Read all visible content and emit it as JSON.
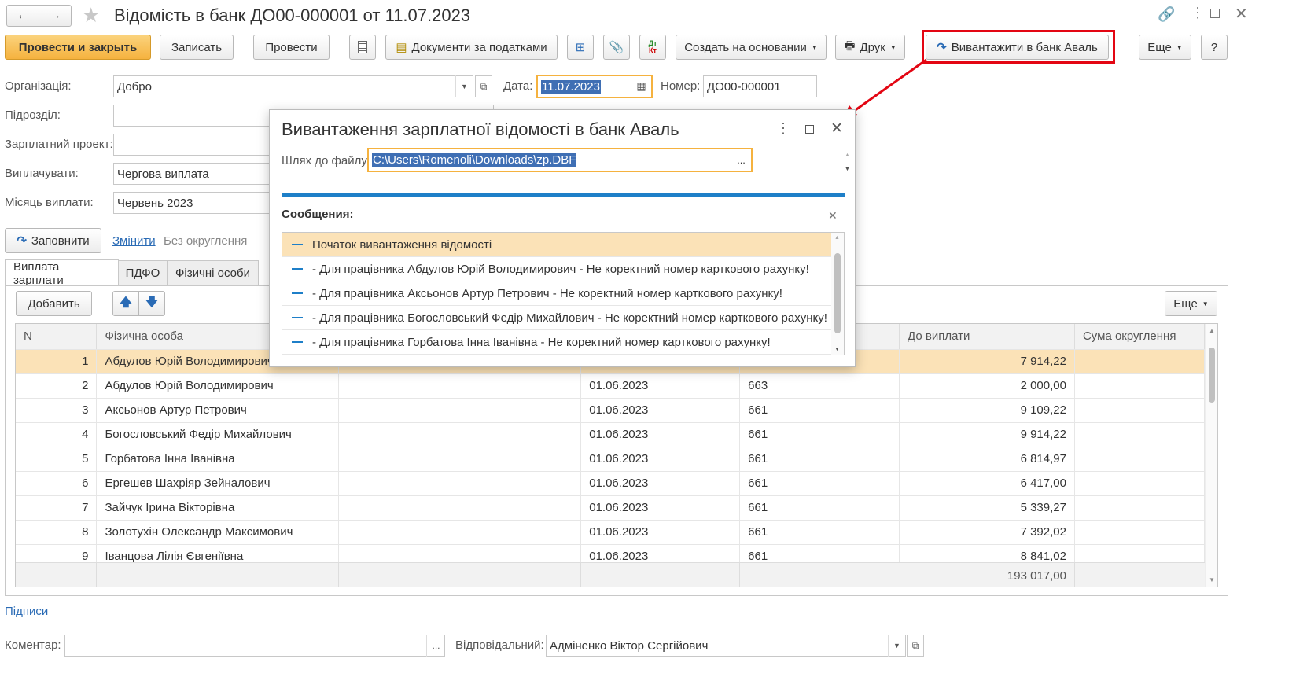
{
  "window": {
    "title": "Відомість в банк ДО00-000001 от 11.07.2023"
  },
  "toolbar": {
    "post_close": "Провести и закрыть",
    "save": "Записать",
    "post": "Провести",
    "tax_docs": "Документи за податками",
    "create_based": "Создать на основании",
    "print": "Друк",
    "export_bank": "Вивантажити в банк Аваль",
    "more": "Еще",
    "help": "?"
  },
  "form": {
    "org_label": "Організація:",
    "org_value": "Добро",
    "date_label": "Дата:",
    "date_value": "11.07.2023",
    "number_label": "Номер:",
    "number_value": "ДО00-000001",
    "subdivision_label": "Підрозділ:",
    "subdivision_value": "",
    "salary_project_label": "Зарплатний проект:",
    "salary_project_value": "",
    "pay_label": "Виплачувати:",
    "pay_value": "Чергова виплата",
    "month_label": "Місяць виплати:",
    "month_value": "Червень 2023",
    "fill_button": "Заповнити",
    "change_link": "Змінити",
    "rounding_text": "Без округлення"
  },
  "tabs": [
    {
      "label": "Виплата зарплати"
    },
    {
      "label": "ПДФО"
    },
    {
      "label": "Фізичні особи"
    }
  ],
  "table_toolbar": {
    "add": "Добавить",
    "more": "Еще"
  },
  "table": {
    "headers": {
      "n": "N",
      "person": "Фізична особа",
      "to_pay": "До виплати",
      "rounding": "Сума округлення"
    },
    "rows": [
      {
        "n": "1",
        "person": "Абдулов Юрій Володимирович",
        "date": "",
        "account": "",
        "amount": "7 914,22"
      },
      {
        "n": "2",
        "person": "Абдулов Юрій Володимирович",
        "date": "01.06.2023",
        "account": "663",
        "amount": "2 000,00"
      },
      {
        "n": "3",
        "person": "Аксьонов Артур Петрович",
        "date": "01.06.2023",
        "account": "661",
        "amount": "9 109,22"
      },
      {
        "n": "4",
        "person": "Богословський Федір Михайлович",
        "date": "01.06.2023",
        "account": "661",
        "amount": "9 914,22"
      },
      {
        "n": "5",
        "person": "Горбатова Інна Іванівна",
        "date": "01.06.2023",
        "account": "661",
        "amount": "6 814,97"
      },
      {
        "n": "6",
        "person": "Ергешев Шахріяр Зейналович",
        "date": "01.06.2023",
        "account": "661",
        "amount": "6 417,00"
      },
      {
        "n": "7",
        "person": "Зайчук Ірина Вікторівна",
        "date": "01.06.2023",
        "account": "661",
        "amount": "5 339,27"
      },
      {
        "n": "8",
        "person": "Золотухін Олександр Максимович",
        "date": "01.06.2023",
        "account": "661",
        "amount": "7 392,02"
      },
      {
        "n": "9",
        "person": "Іванцова Лілія Євгеніївна",
        "date": "01.06.2023",
        "account": "661",
        "amount": "8 841,02"
      }
    ],
    "total": "193 017,00"
  },
  "footer": {
    "signatures_link": "Підписи",
    "comment_label": "Коментар:",
    "comment_value": "",
    "responsible_label": "Відповідальний:",
    "responsible_value": "Адміненко Віктор Сергійович"
  },
  "dialog": {
    "title": "Вивантаження зарплатної відомості в банк Аваль",
    "path_label": "Шлях до файлу:",
    "path_value": "C:\\Users\\Romenoli\\Downloads\\zp.DBF",
    "browse": "...",
    "messages_title": "Сообщения:",
    "messages": [
      "Початок вивантаження відомості",
      "- Для працівника Абдулов Юрій Володимирович - Не коректний номер карткового рахунку!",
      "- Для працівника Аксьонов Артур Петрович - Не коректний номер карткового рахунку!",
      "- Для працівника Богословський Федір Михайлович - Не коректний номер карткового рахунку!",
      "- Для працівника Горбатова Інна Іванівна - Не коректний номер карткового рахунку!"
    ]
  },
  "colors": {
    "accent_orange": "#f5b23f",
    "highlight": "#e30613",
    "selection": "#fbe2b7",
    "progress_blue": "#1e7fc8",
    "link": "#2a6bb5"
  }
}
